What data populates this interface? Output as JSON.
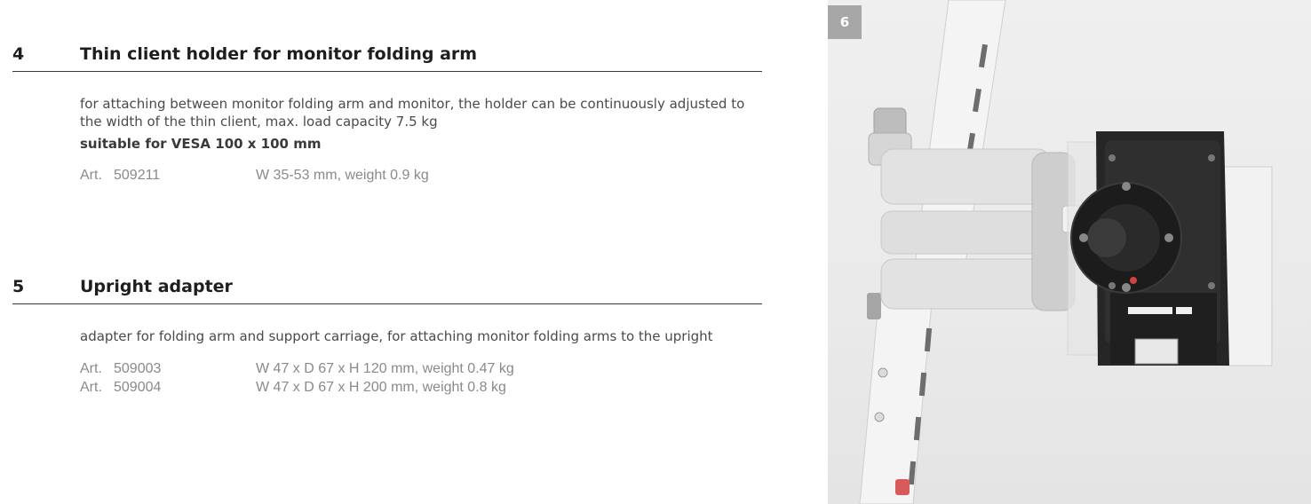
{
  "sections": [
    {
      "number": "4",
      "title": "Thin client holder for monitor folding arm",
      "description": "for attaching between monitor folding arm and monitor, the holder can be continuously adjusted to the width of the thin client, max. load capacity 7.5 kg",
      "suitable": "suitable for VESA 100 x 100 mm",
      "articles": [
        {
          "label": "Art.",
          "number": "509211",
          "spec": "W 35-53 mm, weight 0.9 kg"
        }
      ]
    },
    {
      "number": "5",
      "title": "Upright adapter",
      "description": "adapter for folding arm and support carriage, for attaching monitor folding arms to the upright",
      "articles": [
        {
          "label": "Art.",
          "number": "509003",
          "spec": "W 47 x D 67 x H 120 mm, weight 0.47 kg"
        },
        {
          "label": "Art.",
          "number": "509004",
          "spec": "W 47 x D 67 x H 200 mm, weight 0.8 kg"
        }
      ]
    }
  ],
  "figure": {
    "badge": "6"
  }
}
